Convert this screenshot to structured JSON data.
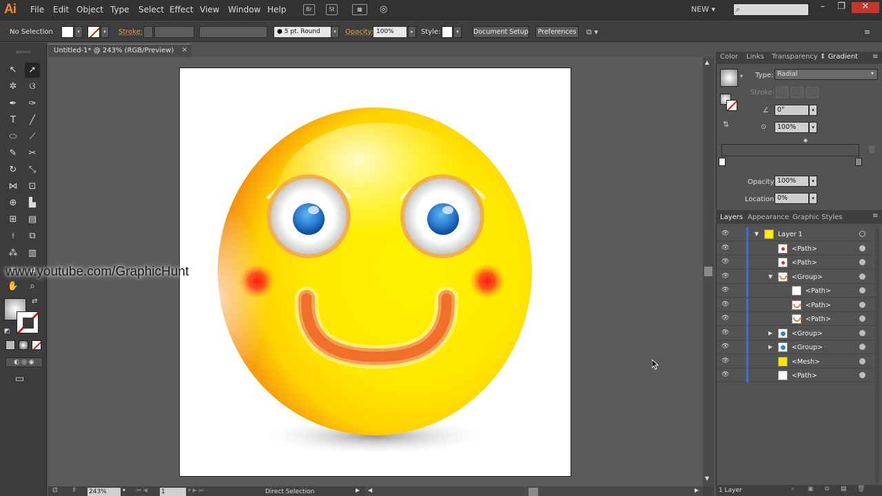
{
  "app": {
    "logo": "Ai",
    "menu": [
      "File",
      "Edit",
      "Object",
      "Type",
      "Select",
      "Effect",
      "View",
      "Window",
      "Help"
    ],
    "bridge_icon": "Br",
    "stock_icon": "St",
    "workspace": "NEW",
    "window_controls": [
      "–",
      "❐",
      "✕"
    ]
  },
  "control_bar": {
    "selection_state": "No Selection",
    "stroke_label": "Stroke:",
    "brush": "5 pt. Round",
    "opacity_label": "Opacity:",
    "opacity_value": "100%",
    "style_label": "Style:",
    "document_setup": "Document Setup",
    "preferences": "Preferences"
  },
  "document": {
    "tab_title": "Untitled-1* @ 243% (RGB/Preview)",
    "tab_close": "×",
    "zoom": "243%",
    "page": "1",
    "status_tool": "Direct Selection"
  },
  "gradient_panel": {
    "tabs": [
      "Color",
      "Links",
      "Transparency",
      "Gradient"
    ],
    "active_tab": "Gradient",
    "type_label": "Type:",
    "type_value": "Radial",
    "stroke_label": "Stroke:",
    "angle_value": "0°",
    "aspect_value": "100%",
    "opacity_label": "Opacity:",
    "opacity_value": "100%",
    "location_label": "Location:",
    "location_value": "0%"
  },
  "layers_panel": {
    "tabs": [
      "Layers",
      "Appearance",
      "Graphic Styles"
    ],
    "active_tab": "Layers",
    "rows": [
      {
        "name": "Layer 1",
        "indent": 0,
        "arrow": "▼"
      },
      {
        "name": "<Path>",
        "indent": 1,
        "arrow": ""
      },
      {
        "name": "<Path>",
        "indent": 1,
        "arrow": ""
      },
      {
        "name": "<Group>",
        "indent": 1,
        "arrow": "▼"
      },
      {
        "name": "<Path>",
        "indent": 2,
        "arrow": ""
      },
      {
        "name": "<Path>",
        "indent": 2,
        "arrow": ""
      },
      {
        "name": "<Path>",
        "indent": 2,
        "arrow": ""
      },
      {
        "name": "<Group>",
        "indent": 1,
        "arrow": "▶"
      },
      {
        "name": "<Group>",
        "indent": 1,
        "arrow": "▶"
      },
      {
        "name": "<Mesh>",
        "indent": 1,
        "arrow": ""
      },
      {
        "name": "<Path>",
        "indent": 1,
        "arrow": ""
      }
    ],
    "footer": "1 Layer"
  },
  "watermark": "www.youtube.com/GraphicHunt",
  "colors": {
    "accent_orange": "#ef8a2b",
    "layer_blue": "#3d6ed8",
    "face_yellow": "#ffe600",
    "smile_orange": "#f0702a",
    "eye_blue": "#2f86d6"
  }
}
